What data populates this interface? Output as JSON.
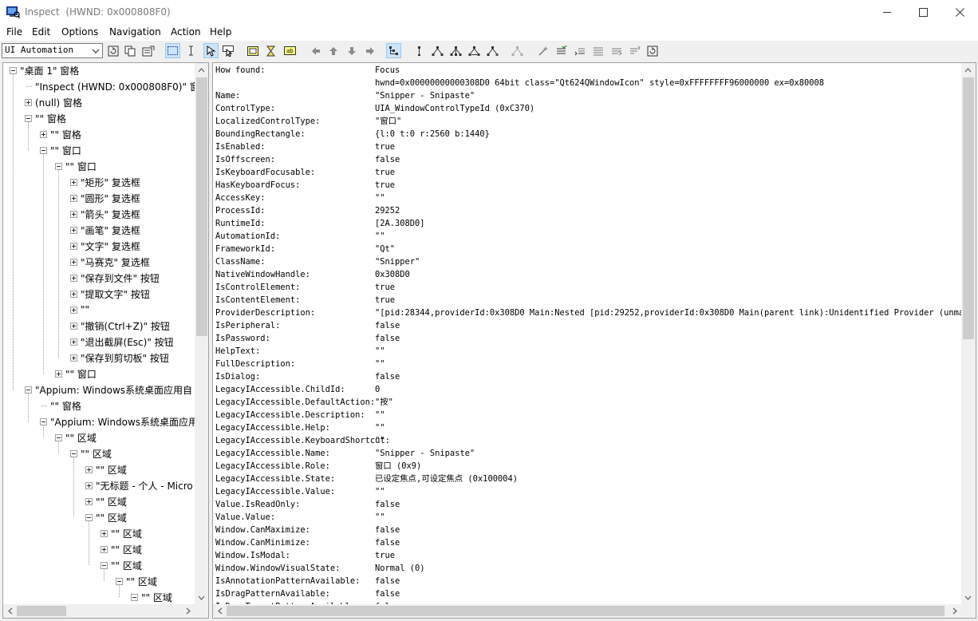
{
  "window": {
    "title": "Inspect  (HWND: 0x000808F0)"
  },
  "menu": [
    "File",
    "Edit",
    "Options",
    "Navigation",
    "Action",
    "Help"
  ],
  "toolbar": {
    "mode_select": "UI Automation"
  },
  "tree": [
    {
      "label": "\"桌面 1\" 窗格",
      "toggle": "minus"
    },
    {
      "label": "\"Inspect  (HWND: 0x000808F0)\" 窗",
      "toggle": "none"
    },
    {
      "label": "(null) 窗格",
      "toggle": "plus"
    },
    {
      "label": "\"\" 窗格",
      "toggle": "minus"
    },
    {
      "label": "\"\" 窗格",
      "toggle": "plus"
    },
    {
      "label": "\"\" 窗口",
      "toggle": "minus"
    },
    {
      "label": "\"\" 窗口",
      "toggle": "minus"
    },
    {
      "label": "\"矩形\" 复选框",
      "toggle": "plus"
    },
    {
      "label": "\"圆形\" 复选框",
      "toggle": "plus"
    },
    {
      "label": "\"箭头\" 复选框",
      "toggle": "plus"
    },
    {
      "label": "\"画笔\" 复选框",
      "toggle": "plus"
    },
    {
      "label": "\"文字\" 复选框",
      "toggle": "plus"
    },
    {
      "label": "\"马赛克\" 复选框",
      "toggle": "plus"
    },
    {
      "label": "\"保存到文件\" 按钮",
      "toggle": "plus"
    },
    {
      "label": "\"提取文字\" 按钮",
      "toggle": "plus"
    },
    {
      "label": "\"\"",
      "toggle": "plus"
    },
    {
      "label": "\"撤销(Ctrl+Z)\" 按钮",
      "toggle": "plus"
    },
    {
      "label": "\"退出截屏(Esc)\" 按钮",
      "toggle": "plus"
    },
    {
      "label": "\"保存到剪切板\" 按钮",
      "toggle": "plus"
    },
    {
      "label": "\"\" 窗口",
      "toggle": "plus"
    },
    {
      "label": "\"Appium: Windows系统桌面应用自",
      "toggle": "minus"
    },
    {
      "label": "\"\" 窗格",
      "toggle": "none"
    },
    {
      "label": "\"Appium: Windows系统桌面应用",
      "toggle": "minus"
    },
    {
      "label": "\"\" 区域",
      "toggle": "minus"
    },
    {
      "label": "\"\" 区域",
      "toggle": "minus"
    },
    {
      "label": "\"\" 区域",
      "toggle": "plus"
    },
    {
      "label": "\"无标题 - 个人 - Micro",
      "toggle": "plus"
    },
    {
      "label": "\"\" 区域",
      "toggle": "plus"
    },
    {
      "label": "\"\" 区域",
      "toggle": "minus"
    },
    {
      "label": "\"\" 区域",
      "toggle": "plus"
    },
    {
      "label": "\"\" 区域",
      "toggle": "plus"
    },
    {
      "label": "\"\" 区域",
      "toggle": "minus"
    },
    {
      "label": "\"\" 区域",
      "toggle": "minus"
    },
    {
      "label": "\"\" 区域",
      "toggle": "minus"
    }
  ],
  "properties": [
    {
      "k": "How found:",
      "v": "Focus"
    },
    {
      "k": "",
      "v": "hwnd=0x00000000000308D0 64bit class=\"Qt624QWindowIcon\" style=0xFFFFFFFF96000000 ex=0x80008"
    },
    {
      "k": "Name:",
      "v": "\"Snipper - Snipaste\""
    },
    {
      "k": "ControlType:",
      "v": "UIA_WindowControlTypeId (0xC370)"
    },
    {
      "k": "LocalizedControlType:",
      "v": "\"窗口\""
    },
    {
      "k": "BoundingRectangle:",
      "v": "{l:0 t:0 r:2560 b:1440}"
    },
    {
      "k": "IsEnabled:",
      "v": "true"
    },
    {
      "k": "IsOffscreen:",
      "v": "false"
    },
    {
      "k": "IsKeyboardFocusable:",
      "v": "true"
    },
    {
      "k": "HasKeyboardFocus:",
      "v": "true"
    },
    {
      "k": "AccessKey:",
      "v": "\"\""
    },
    {
      "k": "ProcessId:",
      "v": "29252"
    },
    {
      "k": "RuntimeId:",
      "v": "[2A.308D0]"
    },
    {
      "k": "AutomationId:",
      "v": "\"\""
    },
    {
      "k": "FrameworkId:",
      "v": "\"Qt\""
    },
    {
      "k": "ClassName:",
      "v": "\"Snipper\""
    },
    {
      "k": "NativeWindowHandle:",
      "v": "0x308D0"
    },
    {
      "k": "IsControlElement:",
      "v": "true"
    },
    {
      "k": "IsContentElement:",
      "v": "true"
    },
    {
      "k": "ProviderDescription:",
      "v": "\"[pid:28344,providerId:0x308D0 Main:Nested [pid:29252,providerId:0x308D0 Main(parent link):Unidentified Provider (unmanaged"
    },
    {
      "k": "IsPeripheral:",
      "v": "false"
    },
    {
      "k": "IsPassword:",
      "v": "false"
    },
    {
      "k": "HelpText:",
      "v": "\"\""
    },
    {
      "k": "FullDescription:",
      "v": "\"\""
    },
    {
      "k": "IsDialog:",
      "v": "false"
    },
    {
      "k": "LegacyIAccessible.ChildId:",
      "v": "0"
    },
    {
      "k": "LegacyIAccessible.DefaultAction:",
      "v": "\"按\""
    },
    {
      "k": "LegacyIAccessible.Description:",
      "v": "\"\""
    },
    {
      "k": "LegacyIAccessible.Help:",
      "v": "\"\""
    },
    {
      "k": "LegacyIAccessible.KeyboardShortcut:",
      "v": "   \"\""
    },
    {
      "k": "LegacyIAccessible.Name:",
      "v": "\"Snipper - Snipaste\""
    },
    {
      "k": "LegacyIAccessible.Role:",
      "v": "窗口 (0x9)"
    },
    {
      "k": "LegacyIAccessible.State:",
      "v": "已设定焦点,可设定焦点 (0x100004)"
    },
    {
      "k": "LegacyIAccessible.Value:",
      "v": "\"\""
    },
    {
      "k": "Value.IsReadOnly:",
      "v": "false"
    },
    {
      "k": "Value.Value:",
      "v": "\"\""
    },
    {
      "k": "Window.CanMaximize:",
      "v": "false"
    },
    {
      "k": "Window.CanMinimize:",
      "v": "false"
    },
    {
      "k": "Window.IsModal:",
      "v": "true"
    },
    {
      "k": "Window.WindowVisualState:",
      "v": "Normal (0)"
    },
    {
      "k": "IsAnnotationPatternAvailable:",
      "v": "false"
    },
    {
      "k": "IsDragPatternAvailable:",
      "v": "false"
    },
    {
      "k": "IsDropTargetPatternAvailable:",
      "v": "false"
    }
  ]
}
